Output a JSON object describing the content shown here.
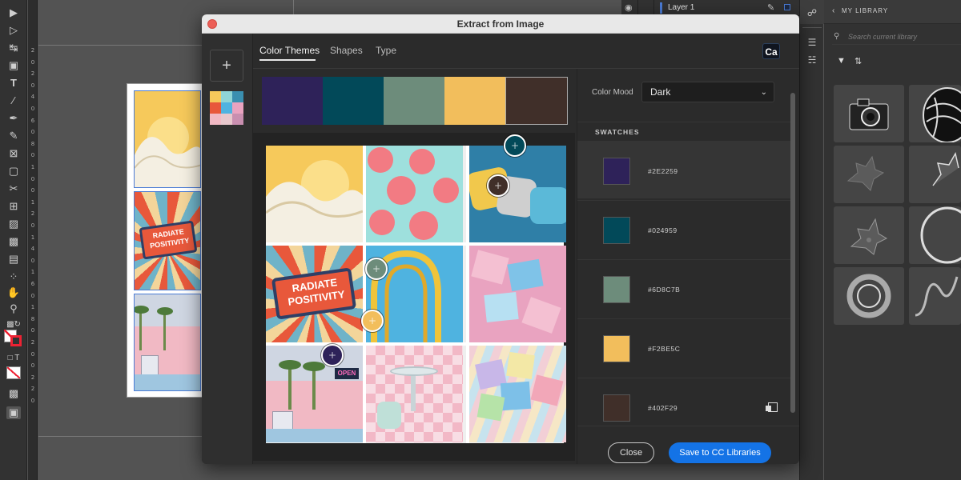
{
  "dialog": {
    "title": "Extract from Image",
    "tabs": [
      {
        "label": "Color Themes",
        "active": true
      },
      {
        "label": "Shapes",
        "active": false
      },
      {
        "label": "Type",
        "active": false
      }
    ],
    "add_label": "+",
    "badge": "Ca",
    "color_mood_label": "Color Mood",
    "color_mood_value": "Dark",
    "swatches_header": "SWATCHES",
    "swatches": [
      {
        "hex": "#2E2259",
        "color": "#2E2259"
      },
      {
        "hex": "#024959",
        "color": "#024959"
      },
      {
        "hex": "#6D8C7B",
        "color": "#6D8C7B"
      },
      {
        "hex": "#F2BE5C",
        "color": "#F2BE5C"
      },
      {
        "hex": "#402F29",
        "color": "#402F29"
      }
    ],
    "close_label": "Close",
    "save_label": "Save to CC Libraries"
  },
  "layers": {
    "name": "Layer 1"
  },
  "library": {
    "header": "MY LIBRARY",
    "search_placeholder": "Search current library",
    "back_icon": "chevron-left-icon"
  },
  "artwork": {
    "sign_line1": "RADIATE",
    "sign_line2": "POSITIVITY",
    "neon_sign": "OPEN"
  },
  "ruler": {
    "ticks": [
      "2",
      "0",
      "2",
      "0",
      "4",
      "0",
      "6",
      "0",
      "8",
      "0",
      "1",
      "0",
      "0",
      "1",
      "2",
      "0",
      "1",
      "4",
      "0",
      "1",
      "6",
      "0",
      "1",
      "8",
      "0",
      "2",
      "0",
      "0",
      "2",
      "2",
      "0"
    ]
  }
}
